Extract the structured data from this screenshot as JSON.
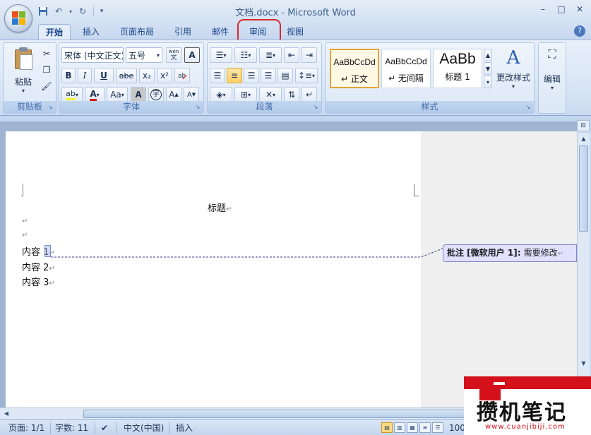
{
  "window": {
    "title": "文档.docx - Microsoft Word"
  },
  "quick_access": {
    "save_icon": "save-icon",
    "undo_icon": "undo-icon",
    "redo_icon": "redo-icon"
  },
  "tabs": [
    {
      "label": "开始",
      "active": true
    },
    {
      "label": "插入"
    },
    {
      "label": "页面布局"
    },
    {
      "label": "引用"
    },
    {
      "label": "邮件"
    },
    {
      "label": "审阅"
    },
    {
      "label": "视图"
    }
  ],
  "ribbon": {
    "clipboard": {
      "label": "剪贴板",
      "paste_label": "粘贴"
    },
    "font": {
      "label": "字体",
      "font_name": "宋体 (中文正文)",
      "font_size": "五号",
      "bold": "B",
      "italic": "I",
      "underline": "U",
      "strikethrough": "abe",
      "subscript": "x₂",
      "superscript": "x²",
      "wen_label": "wén",
      "wen_char": "文",
      "char_border": "A",
      "font_color": "A",
      "change_case": "Aa",
      "char_shading": "A",
      "enclose_char": "字",
      "grow_font": "A",
      "shrink_font": "A",
      "highlight_text": "ab"
    },
    "paragraph": {
      "label": "段落"
    },
    "styles": {
      "label": "样式",
      "items": [
        {
          "sample": "AaBbCcDd",
          "name": "↵ 正文"
        },
        {
          "sample": "AaBbCcDd",
          "name": "↵ 无间隔"
        },
        {
          "sample": "AaBb",
          "name": "标题 1"
        }
      ],
      "change_styles": "更改样式"
    },
    "editing": {
      "label": "编辑"
    }
  },
  "document": {
    "title_line": "标题",
    "lines": [
      "内容 1",
      "内容 2",
      "内容 3"
    ],
    "para_mark": "↵"
  },
  "comment": {
    "prefix": "批注 [",
    "author": "微软用户 1",
    "suffix": "]: ",
    "text": "需要修改"
  },
  "statusbar": {
    "page": "页面: 1/1",
    "words": "字数: 11",
    "language": "中文(中国)",
    "mode": "插入",
    "zoom": "100"
  },
  "watermark": {
    "text": "攒机笔记",
    "url": "www.cuanjibiji.com"
  }
}
